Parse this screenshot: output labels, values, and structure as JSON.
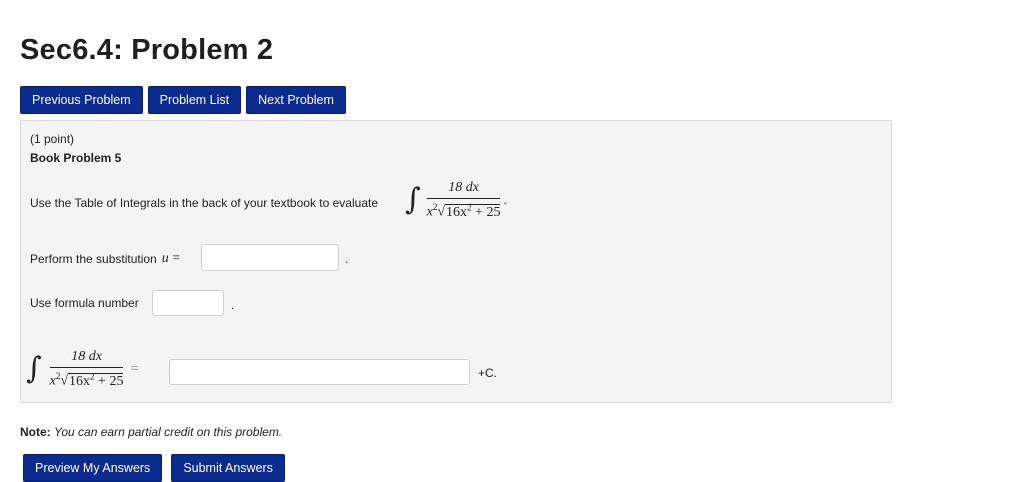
{
  "page": {
    "title": "Sec6.4: Problem 2"
  },
  "nav": {
    "previous": "Previous Problem",
    "list": "Problem List",
    "next": "Next Problem"
  },
  "problem": {
    "points": "(1 point)",
    "heading": "Book Problem 5",
    "prompt": "Use the Table of Integrals in the back of your textbook to evaluate",
    "integral": {
      "numerator": "18 dx",
      "den_var": "x",
      "den_exp": "2",
      "radicand_coef": "16x",
      "radicand_exp": "2",
      "radicand_tail": "+ 25",
      "period": "."
    },
    "substitution": {
      "label": "Perform the substitution",
      "var": "u",
      "eq": "=",
      "value": "",
      "period": "."
    },
    "formula": {
      "label": "Use formula number",
      "value": "",
      "period": "."
    },
    "answer": {
      "eq": "=",
      "value": "",
      "suffix": "+C."
    }
  },
  "note": {
    "label": "Note:",
    "text": "You can earn partial credit on this problem."
  },
  "actions": {
    "preview": "Preview My Answers",
    "submit": "Submit Answers"
  },
  "colors": {
    "button_bg": "#0b2b8f",
    "panel_bg": "#f4f4f4"
  }
}
